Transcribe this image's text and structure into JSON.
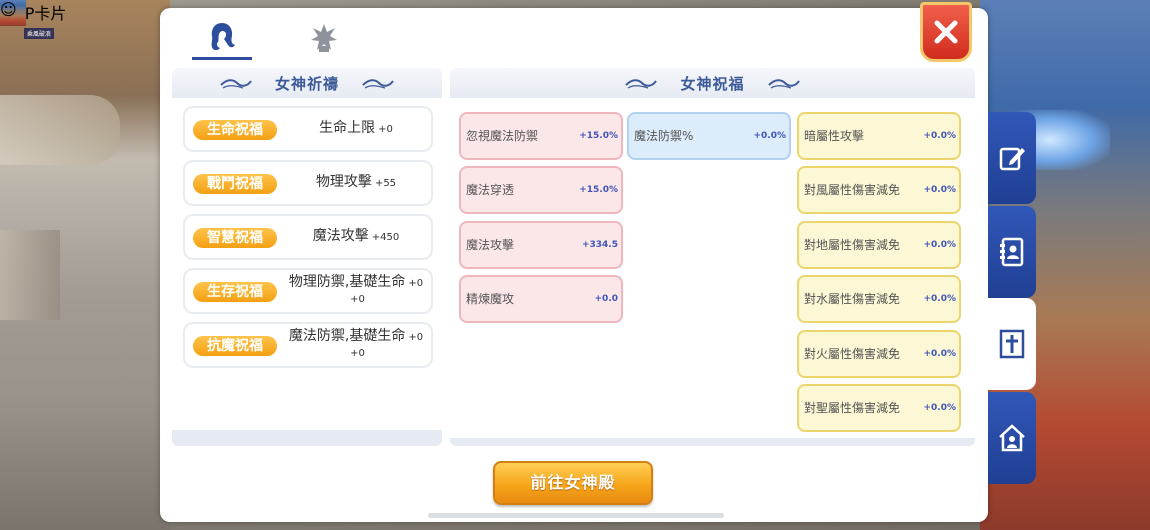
{
  "background": {
    "card_label": "MVP卡片",
    "chat_bubble_icon": "smiley-icon",
    "nameplate": "乘風破浪"
  },
  "tabs": [
    {
      "icon": "goddess-head-icon",
      "active": true
    },
    {
      "icon": "crystal-emblem-icon",
      "active": false
    }
  ],
  "close_icon": "close-icon",
  "left_panel": {
    "title": "女神祈禱",
    "blessings": [
      {
        "tag": "生命祝福",
        "stat": "生命上限",
        "value": "+0"
      },
      {
        "tag": "戰鬥祝福",
        "stat": "物理攻擊",
        "value": "+55"
      },
      {
        "tag": "智慧祝福",
        "stat": "魔法攻擊",
        "value": "+450"
      },
      {
        "tag": "生存祝福",
        "stat": "物理防禦,基礎生命",
        "value": "+0",
        "value2": "+0"
      },
      {
        "tag": "抗魔祝福",
        "stat": "魔法防禦,基礎生命",
        "value": "+0",
        "value2": "+0"
      }
    ]
  },
  "right_panel": {
    "title": "女神祝福",
    "col1": [
      {
        "name": "忽視魔法防禦",
        "value": "+15.0%"
      },
      {
        "name": "魔法穿透",
        "value": "+15.0%"
      },
      {
        "name": "魔法攻擊",
        "value": "+334.5"
      },
      {
        "name": "精煉魔攻",
        "value": "+0.0"
      }
    ],
    "col2": [
      {
        "name": "魔法防禦%",
        "value": "+0.0%"
      }
    ],
    "col3": [
      {
        "name": "暗屬性攻擊",
        "value": "+0.0%"
      },
      {
        "name": "對風屬性傷害減免",
        "value": "+0.0%"
      },
      {
        "name": "對地屬性傷害減免",
        "value": "+0.0%"
      },
      {
        "name": "對水屬性傷害減免",
        "value": "+0.0%"
      },
      {
        "name": "對火屬性傷害減免",
        "value": "+0.0%"
      },
      {
        "name": "對聖屬性傷害減免",
        "value": "+0.0%"
      }
    ]
  },
  "go_button": "前往女神殿",
  "side_tabs": [
    {
      "icon": "edit-icon",
      "active": false
    },
    {
      "icon": "contacts-book-icon",
      "active": false
    },
    {
      "icon": "cross-emblem-icon",
      "active": true
    },
    {
      "icon": "guild-house-icon",
      "active": false
    }
  ]
}
